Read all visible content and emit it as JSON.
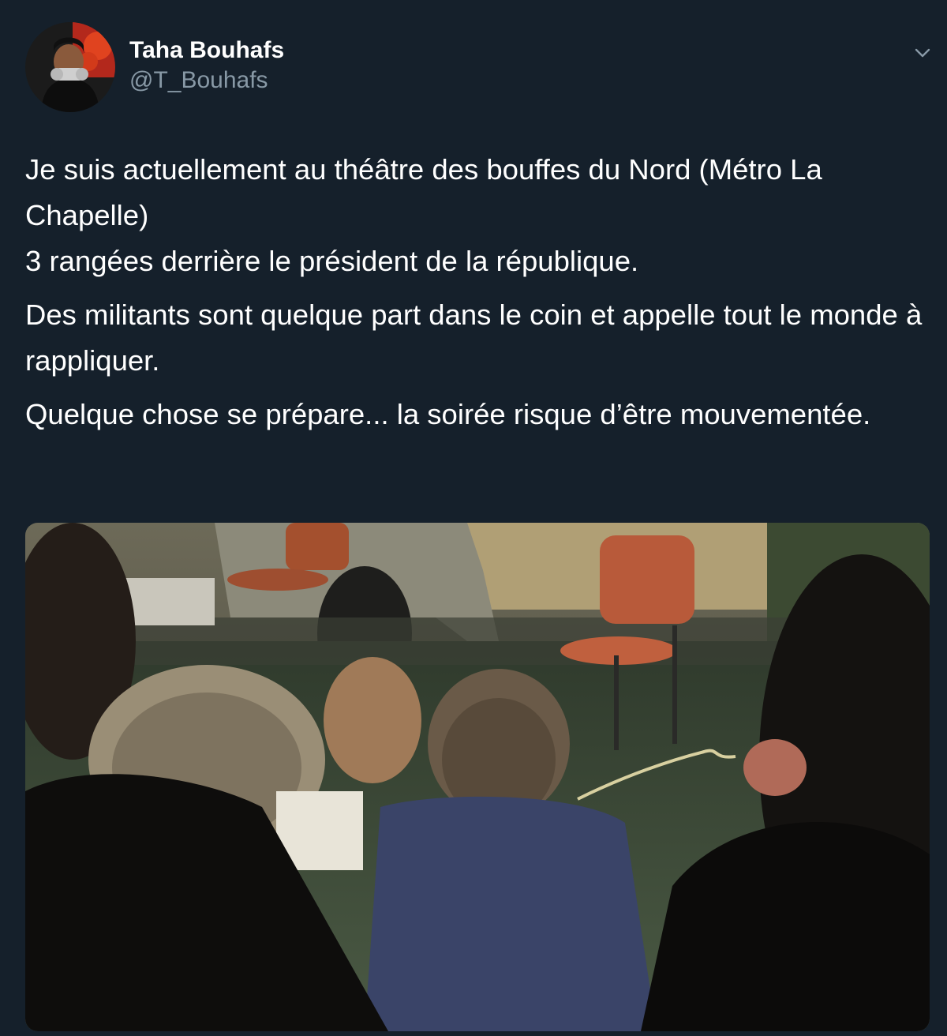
{
  "author": {
    "display_name": "Taha Bouhafs",
    "handle": "@T_Bouhafs",
    "avatar_icon": "profile-photo"
  },
  "menu": {
    "icon": "chevron-down-icon"
  },
  "tweet": {
    "paragraphs": [
      {
        "lines": [
          "Je suis actuellement au théâtre des bouffes du Nord (Métro La Chapelle)",
          "3 rangées derrière le président de la république."
        ]
      },
      {
        "lines": [
          "Des militants sont quelque part dans le coin et appelle tout le monde à rappliquer."
        ]
      },
      {
        "lines": [
          "Quelque chose se prépare... la soirée risque d’être mouvementée."
        ]
      }
    ]
  },
  "media": {
    "type": "video-thumbnail"
  },
  "colors": {
    "background": "#15202b",
    "text_primary": "#ffffff",
    "text_secondary": "#8899a6"
  }
}
